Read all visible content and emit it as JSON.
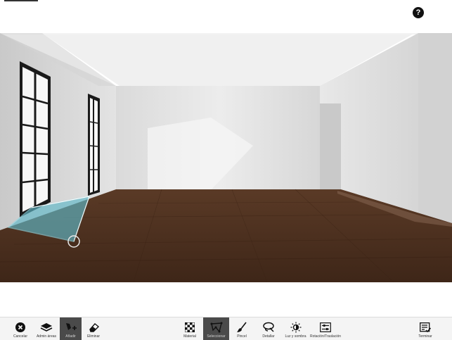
{
  "header": {
    "help_label": "?"
  },
  "toolbar": {
    "left": [
      {
        "label": "Cancelar",
        "icon": "close-circle-icon",
        "active": false
      },
      {
        "label": "Admin áreas",
        "icon": "layers-icon",
        "active": false
      },
      {
        "label": "Añadir",
        "icon": "add-area-icon",
        "active": true
      },
      {
        "label": "Eliminar",
        "icon": "eraser-icon",
        "active": false
      }
    ],
    "center": [
      {
        "label": "Material",
        "icon": "checkerboard-icon",
        "active": false
      },
      {
        "label": "Seleccionar",
        "icon": "polygon-select-icon",
        "active": true
      },
      {
        "label": "Pincel",
        "icon": "brush-icon",
        "active": false
      },
      {
        "label": "Detallar",
        "icon": "lasso-icon",
        "active": false
      },
      {
        "label": "Luz y sombra",
        "icon": "sun-icon",
        "active": false
      },
      {
        "label": "Rotación/Traslación",
        "icon": "sliders-icon",
        "active": false
      }
    ],
    "right": [
      {
        "label": "Terminar",
        "icon": "finish-icon",
        "active": false
      }
    ]
  },
  "colors": {
    "floor": "#4d3020",
    "wall": "#e4e4e4",
    "ceiling": "#f1f1f1",
    "selection": "#5fb8c8",
    "toolbar_active": "#4a4a4a"
  }
}
